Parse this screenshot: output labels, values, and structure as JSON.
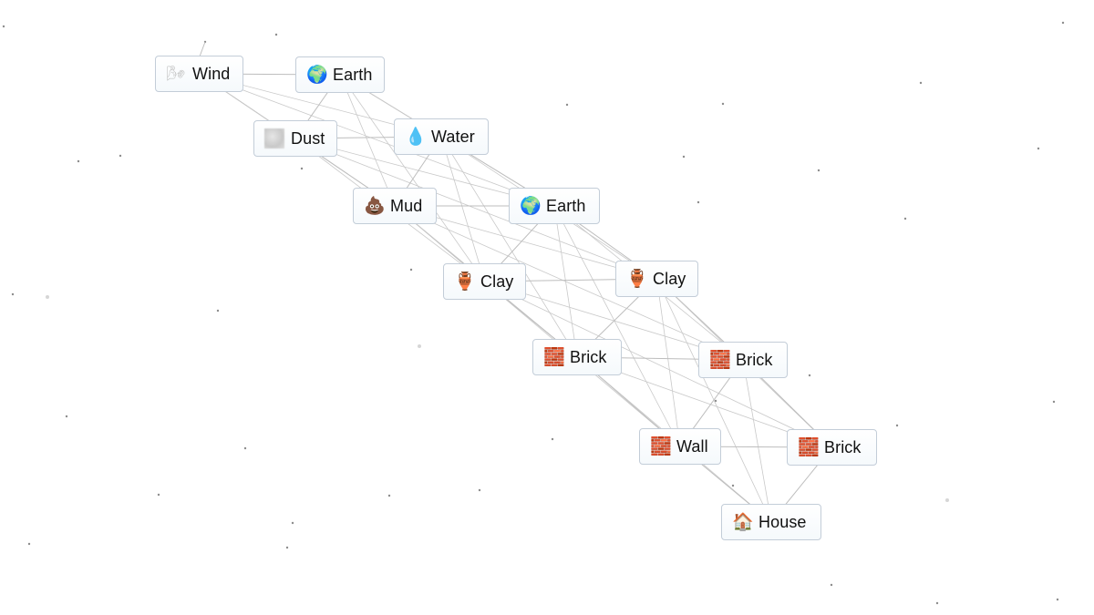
{
  "app": {
    "name": "Infinite Craft canvas",
    "background_color": "#ffffff",
    "node_border_color": "#c3cdd8",
    "link_color": "#c9c9c9"
  },
  "nodes": [
    {
      "id": "wind",
      "label": "Wind",
      "icon": "wind-face-icon",
      "glyph": "🌬",
      "cls": "wind"
    },
    {
      "id": "earth1",
      "label": "Earth",
      "icon": "globe-africa-icon",
      "glyph": "🌍",
      "cls": "earth"
    },
    {
      "id": "dust",
      "label": "Dust",
      "icon": "dust-cloud-icon",
      "glyph": "",
      "cls": "dust"
    },
    {
      "id": "water",
      "label": "Water",
      "icon": "droplet-icon",
      "glyph": "💧",
      "cls": "water"
    },
    {
      "id": "mud",
      "label": "Mud",
      "icon": "pile-of-poo-icon",
      "glyph": "💩",
      "cls": "mud"
    },
    {
      "id": "earth2",
      "label": "Earth",
      "icon": "globe-africa-icon",
      "glyph": "🌍",
      "cls": "earth"
    },
    {
      "id": "clay1",
      "label": "Clay",
      "icon": "amphora-icon",
      "glyph": "🏺",
      "cls": "clay"
    },
    {
      "id": "clay2",
      "label": "Clay",
      "icon": "amphora-icon",
      "glyph": "🏺",
      "cls": "clay"
    },
    {
      "id": "brick1",
      "label": "Brick",
      "icon": "brick-icon",
      "glyph": "🧱",
      "cls": "brick"
    },
    {
      "id": "brick2",
      "label": "Brick",
      "icon": "brick-icon",
      "glyph": "🧱",
      "cls": "brick"
    },
    {
      "id": "wall",
      "label": "Wall",
      "icon": "brick-icon",
      "glyph": "🧱",
      "cls": "brick"
    },
    {
      "id": "brick3",
      "label": "Brick",
      "icon": "brick-icon",
      "glyph": "🧱",
      "cls": "brick"
    },
    {
      "id": "house",
      "label": "House",
      "icon": "house-icon",
      "glyph": "🏠",
      "cls": "house"
    }
  ],
  "combinations": [
    {
      "inputs": [
        "Wind",
        "Earth"
      ],
      "result": "Dust"
    },
    {
      "inputs": [
        "Dust",
        "Water"
      ],
      "result": "Mud"
    },
    {
      "inputs": [
        "Mud",
        "Earth"
      ],
      "result": "Clay"
    },
    {
      "inputs": [
        "Clay",
        "Clay"
      ],
      "result": "Brick"
    },
    {
      "inputs": [
        "Brick",
        "Brick"
      ],
      "result": "Wall"
    },
    {
      "inputs": [
        "Wall",
        "Brick"
      ],
      "result": "House"
    }
  ]
}
